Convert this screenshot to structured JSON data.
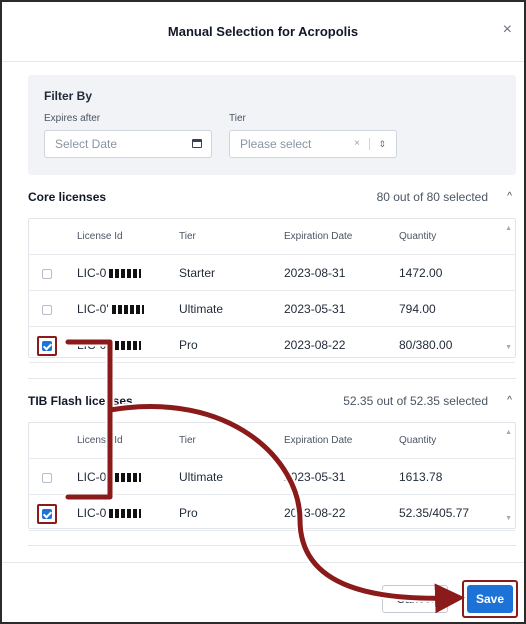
{
  "dialog": {
    "title": "Manual Selection for Acropolis",
    "close_label": "×"
  },
  "filter": {
    "title": "Filter By",
    "expires_label": "Expires after",
    "expires_placeholder": "Select Date",
    "tier_label": "Tier",
    "tier_placeholder": "Please select",
    "clear_glyph": "×",
    "updown_glyph": "⇕"
  },
  "core": {
    "title": "Core licenses",
    "count": "80 out of 80 selected",
    "collapse_glyph": "^",
    "headers": [
      "License Id",
      "Tier",
      "Expiration Date",
      "Quantity"
    ],
    "rows": [
      {
        "id": "LIC-0",
        "tier": "Starter",
        "date": "2023-08-31",
        "qty": "1472.00",
        "checked": false
      },
      {
        "id": "LIC-0'",
        "tier": "Ultimate",
        "date": "2023-05-31",
        "qty": "794.00",
        "checked": false
      },
      {
        "id": "LIC-0",
        "tier": "Pro",
        "date": "2023-08-22",
        "qty": "80/380.00",
        "checked": true
      }
    ]
  },
  "tib": {
    "title": "TIB Flash licenses",
    "count": "52.35 out of 52.35 selected",
    "collapse_glyph": "^",
    "headers": [
      "License Id",
      "Tier",
      "Expiration Date",
      "Quantity"
    ],
    "rows": [
      {
        "id": "LIC-0",
        "tier": "Ultimate",
        "date": "2023-05-31",
        "qty": "1613.78",
        "checked": false
      },
      {
        "id": "LIC-0",
        "tier": "Pro",
        "date": "2023-08-22",
        "qty": "52.35/405.77",
        "checked": true
      }
    ]
  },
  "footer": {
    "cancel_label": "Cancel",
    "save_label": "Save"
  },
  "colors": {
    "accent": "#1d72d8",
    "highlight": "#8b1a1a"
  }
}
